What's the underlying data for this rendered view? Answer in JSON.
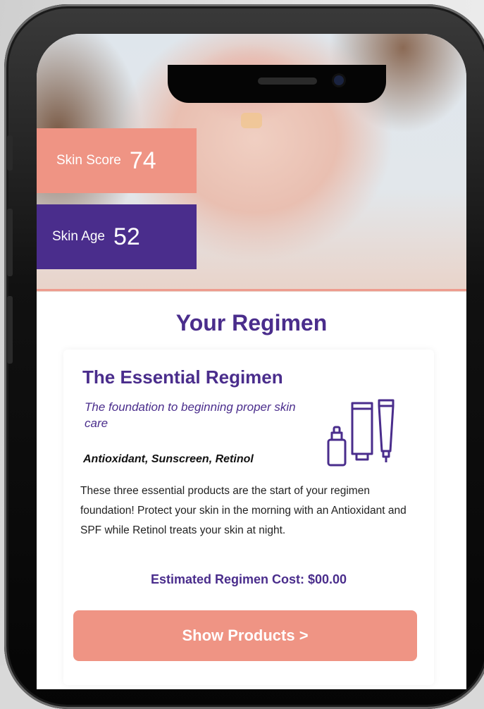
{
  "colors": {
    "coral": "#ef9484",
    "purple": "#4a2d8c",
    "text": "#222222"
  },
  "scores": {
    "skin_score_label": "Skin Score",
    "skin_score_value": "74",
    "skin_age_label": "Skin Age",
    "skin_age_value": "52"
  },
  "regimen": {
    "section_title": "Your Regimen",
    "name": "The Essential Regimen",
    "tagline": "The foundation to beginning proper skin care",
    "ingredients": "Antioxidant,  Sunscreen, Retinol",
    "icon": "skincare-products-icon",
    "description": "These three essential products are the start of your regimen foundation! Protect your skin in the morning with an Antioxidant and SPF while Retinol treats your skin at night.",
    "cost": "Estimated Regimen Cost: $00.00",
    "button_label": "Show Products >"
  }
}
